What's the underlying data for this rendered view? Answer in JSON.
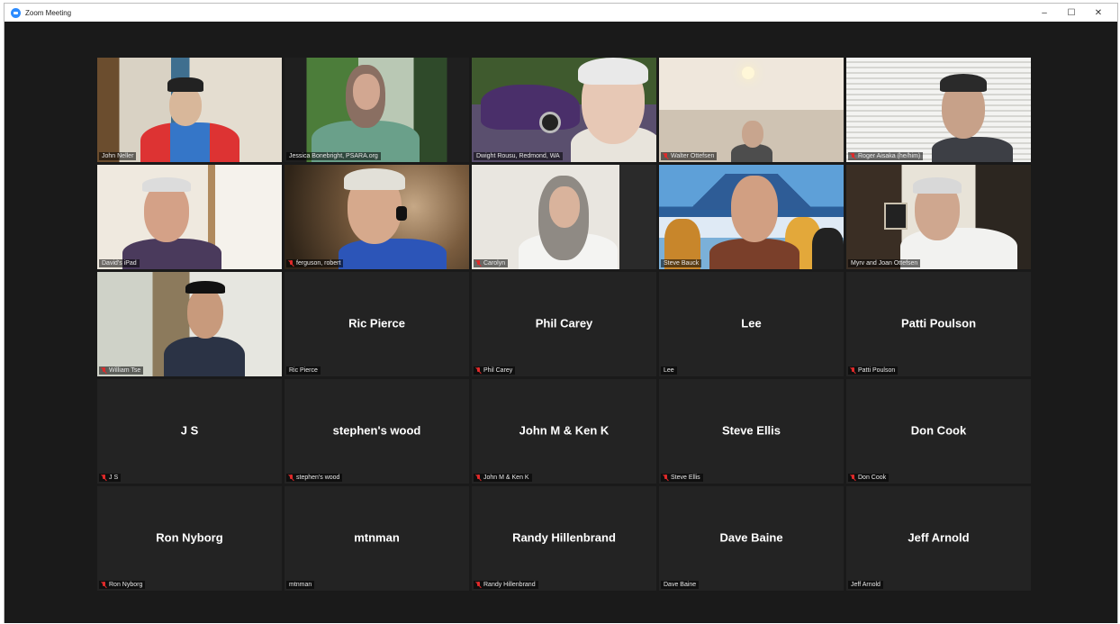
{
  "window": {
    "title": "Zoom Meeting",
    "minimize": "–",
    "maximize": "☐",
    "close": "✕"
  },
  "video_tiles": [
    {
      "name": "John Neller",
      "muted": false
    },
    {
      "name": "Jessica Bonebright, PSARA.org",
      "muted": false
    },
    {
      "name": "Dwight Rousu, Redmond, WA",
      "muted": false
    },
    {
      "name": "Walter Ottefsen",
      "muted": true
    },
    {
      "name": "Roger Aisaka (he/him)",
      "muted": true
    },
    {
      "name": "David's iPad",
      "muted": false
    },
    {
      "name": "ferguson, robert",
      "muted": true
    },
    {
      "name": "Carolyn",
      "muted": true
    },
    {
      "name": "Steve Bauck",
      "muted": false,
      "active_speaker": true
    },
    {
      "name": "Myrv and Joan Ottefsen",
      "muted": false
    },
    {
      "name": "William Tse",
      "muted": true
    }
  ],
  "name_tiles": [
    {
      "display": "Ric Pierce",
      "label": "Ric Pierce",
      "muted": false
    },
    {
      "display": "Phil Carey",
      "label": "Phil Carey",
      "muted": true
    },
    {
      "display": "Lee",
      "label": "Lee",
      "muted": false
    },
    {
      "display": "Patti Poulson",
      "label": "Patti Poulson",
      "muted": true
    },
    {
      "display": "J S",
      "label": "J S",
      "muted": true
    },
    {
      "display": "stephen's wood",
      "label": "stephen's wood",
      "muted": true
    },
    {
      "display": "John M & Ken K",
      "label": "John M & Ken K",
      "muted": true
    },
    {
      "display": "Steve Ellis",
      "label": "Steve Ellis",
      "muted": true
    },
    {
      "display": "Don Cook",
      "label": "Don Cook",
      "muted": true
    },
    {
      "display": "Ron Nyborg",
      "label": "Ron Nyborg",
      "muted": true
    },
    {
      "display": "mtnman",
      "label": "mtnman",
      "muted": false
    },
    {
      "display": "Randy Hillenbrand",
      "label": "Randy Hillenbrand",
      "muted": true
    },
    {
      "display": "Dave Baine",
      "label": "Dave Baine",
      "muted": false
    },
    {
      "display": "Jeff Arnold",
      "label": "Jeff Arnold",
      "muted": false
    }
  ]
}
